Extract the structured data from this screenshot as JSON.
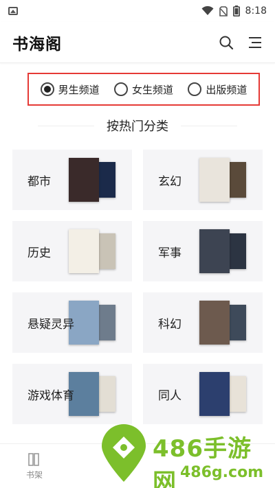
{
  "status_bar": {
    "time": "8:18"
  },
  "app_bar": {
    "title": "书海阁"
  },
  "channels": [
    {
      "label": "男生频道",
      "checked": true
    },
    {
      "label": "女生频道",
      "checked": false
    },
    {
      "label": "出版频道",
      "checked": false
    }
  ],
  "section": {
    "title": "按热门分类"
  },
  "categories": [
    {
      "label": "都市",
      "covers": [
        "#3a2a2a",
        "#1b2a4a"
      ]
    },
    {
      "label": "玄幻",
      "covers": [
        "#e9e4dc",
        "#5a4a3a"
      ]
    },
    {
      "label": "历史",
      "covers": [
        "#f3efe6",
        "#c9c3b6"
      ]
    },
    {
      "label": "军事",
      "covers": [
        "#3d4452",
        "#2c3442"
      ]
    },
    {
      "label": "悬疑灵异",
      "covers": [
        "#8aa6c4",
        "#6e7c8c"
      ]
    },
    {
      "label": "科幻",
      "covers": [
        "#6d5a4e",
        "#3e4a5a"
      ]
    },
    {
      "label": "游戏体育",
      "covers": [
        "#5c7f9e",
        "#e3ded4"
      ]
    },
    {
      "label": "同人",
      "covers": [
        "#2c3f6e",
        "#e8e2d8"
      ]
    }
  ],
  "bottom_nav": {
    "bookshelf_label": "书架"
  },
  "watermark": {
    "brand": "486手游网",
    "domain": "486g.com"
  },
  "colors": {
    "highlight_border": "#e53935",
    "watermark_green": "#7cbf2b"
  }
}
